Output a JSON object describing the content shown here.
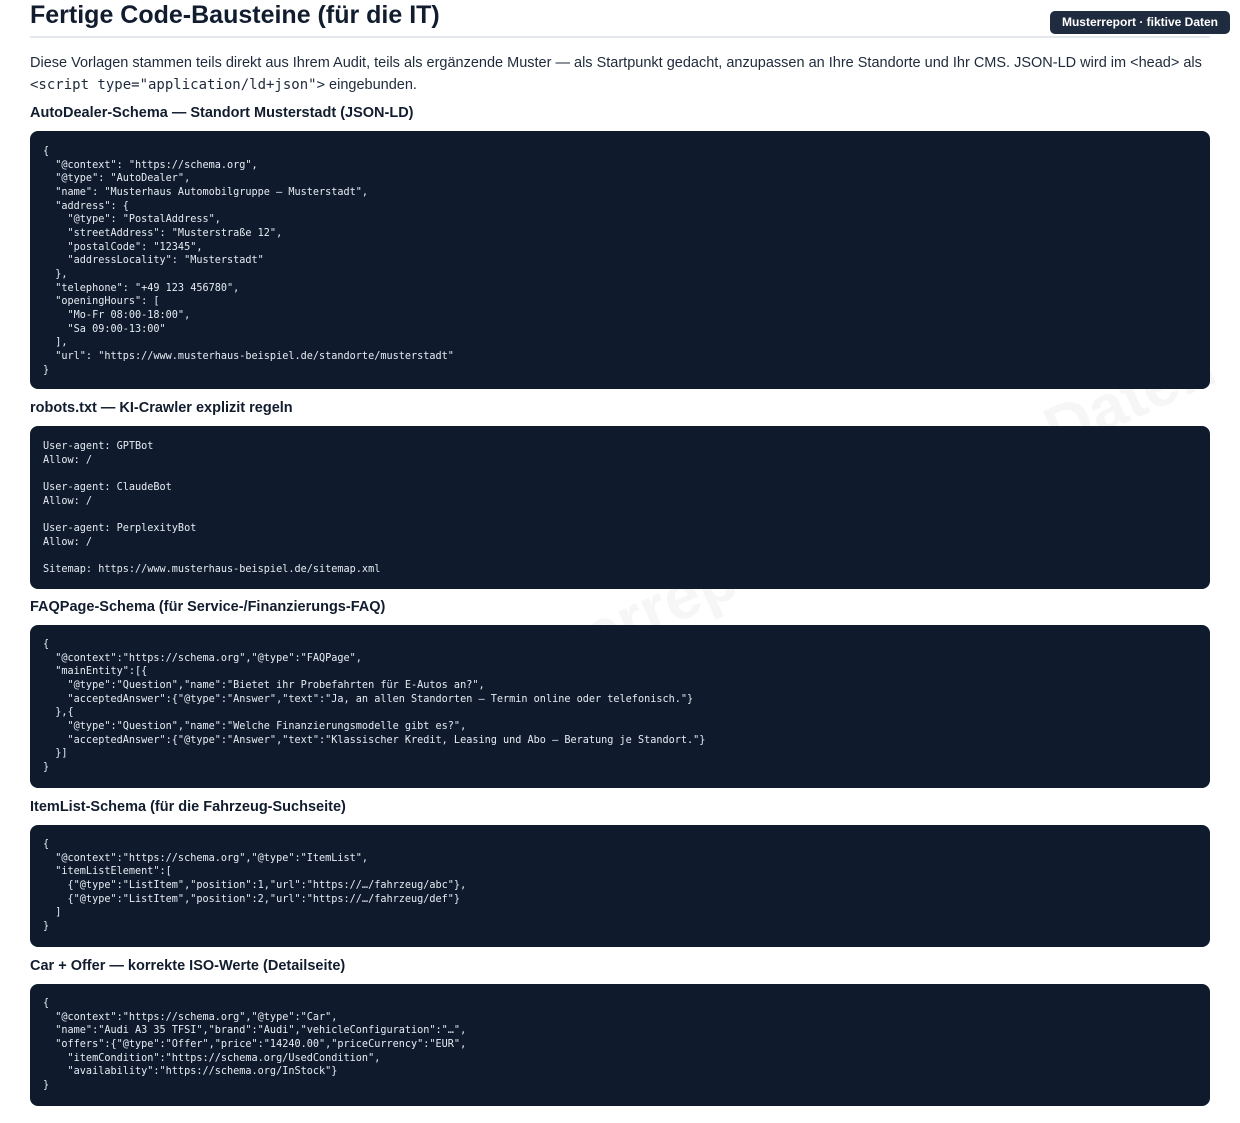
{
  "header": {
    "title": "Fertige Code-Bausteine (für die IT)",
    "badge": "Musterreport · fiktive Daten"
  },
  "intro": {
    "text_before": "Diese Vorlagen stammen teils direkt aus Ihrem Audit, teils als ergänzende Muster — als Startpunkt gedacht, anzupassen an Ihre Standorte und Ihr CMS. JSON-LD wird im <head> als ",
    "code": "<script type=\"application/ld+json\">",
    "text_after": " eingebunden."
  },
  "watermark": "Musterreport · fiktive Daten",
  "sections": [
    {
      "title": "AutoDealer-Schema — Standort Musterstadt (JSON-LD)",
      "code": "{\n  \"@context\": \"https://schema.org\",\n  \"@type\": \"AutoDealer\",\n  \"name\": \"Musterhaus Automobilgruppe – Musterstadt\",\n  \"address\": {\n    \"@type\": \"PostalAddress\",\n    \"streetAddress\": \"Musterstraße 12\",\n    \"postalCode\": \"12345\",\n    \"addressLocality\": \"Musterstadt\"\n  },\n  \"telephone\": \"+49 123 456780\",\n  \"openingHours\": [\n    \"Mo-Fr 08:00-18:00\",\n    \"Sa 09:00-13:00\"\n  ],\n  \"url\": \"https://www.musterhaus-beispiel.de/standorte/musterstadt\"\n}"
    },
    {
      "title": "robots.txt — KI-Crawler explizit regeln",
      "code": "User-agent: GPTBot\nAllow: /\n\nUser-agent: ClaudeBot\nAllow: /\n\nUser-agent: PerplexityBot\nAllow: /\n\nSitemap: https://www.musterhaus-beispiel.de/sitemap.xml"
    },
    {
      "title": "FAQPage-Schema (für Service-/Finanzierungs-FAQ)",
      "code": "{\n  \"@context\":\"https://schema.org\",\"@type\":\"FAQPage\",\n  \"mainEntity\":[{\n    \"@type\":\"Question\",\"name\":\"Bietet ihr Probefahrten für E-Autos an?\",\n    \"acceptedAnswer\":{\"@type\":\"Answer\",\"text\":\"Ja, an allen Standorten – Termin online oder telefonisch.\"}\n  },{\n    \"@type\":\"Question\",\"name\":\"Welche Finanzierungsmodelle gibt es?\",\n    \"acceptedAnswer\":{\"@type\":\"Answer\",\"text\":\"Klassischer Kredit, Leasing und Abo – Beratung je Standort.\"}\n  }]\n}"
    },
    {
      "title": "ItemList-Schema (für die Fahrzeug-Suchseite)",
      "code": "{\n  \"@context\":\"https://schema.org\",\"@type\":\"ItemList\",\n  \"itemListElement\":[\n    {\"@type\":\"ListItem\",\"position\":1,\"url\":\"https://…/fahrzeug/abc\"},\n    {\"@type\":\"ListItem\",\"position\":2,\"url\":\"https://…/fahrzeug/def\"}\n  ]\n}"
    },
    {
      "title": "Car + Offer — korrekte ISO-Werte (Detailseite)",
      "code": "{\n  \"@context\":\"https://schema.org\",\"@type\":\"Car\",\n  \"name\":\"Audi A3 35 TFSI\",\"brand\":\"Audi\",\"vehicleConfiguration\":\"…\",\n  \"offers\":{\"@type\":\"Offer\",\"price\":\"14240.00\",\"priceCurrency\":\"EUR\",\n    \"itemCondition\":\"https://schema.org/UsedCondition\",\n    \"availability\":\"https://schema.org/InStock\"}\n}"
    }
  ]
}
